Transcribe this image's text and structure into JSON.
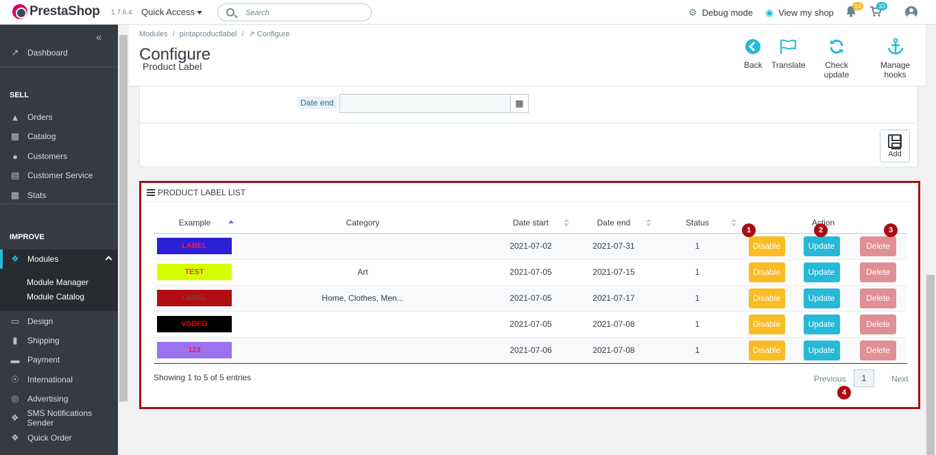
{
  "header": {
    "brand": "PrestaShop",
    "version": "1.7.6.4",
    "quick_access": "Quick Access",
    "search_placeholder": "Search",
    "debug_mode": "Debug mode",
    "view_shop": "View my shop",
    "notifications_count": "14",
    "orders_count": "33"
  },
  "sidebar": {
    "dashboard": "Dashboard",
    "section_sell": "SELL",
    "orders": "Orders",
    "catalog": "Catalog",
    "customers": "Customers",
    "customer_service": "Customer Service",
    "stats": "Stats",
    "section_improve": "IMPROVE",
    "modules": "Modules",
    "module_manager": "Module Manager",
    "module_catalog": "Module Catalog",
    "design": "Design",
    "shipping": "Shipping",
    "payment": "Payment",
    "international": "International",
    "advertising": "Advertising",
    "sms": "SMS Notifications Sender",
    "quick_order": "Quick Order"
  },
  "breadcrumb": {
    "modules": "Modules",
    "module": "pintaproductlabel",
    "current": "Configure"
  },
  "page": {
    "title": "Configure",
    "subtitle": "Product Label"
  },
  "toolbar": {
    "back": "Back",
    "translate": "Translate",
    "check_update": "Check update",
    "manage_hooks": "Manage hooks"
  },
  "form": {
    "date_end_label": "Date end",
    "date_end_value": "",
    "add_label": "Add"
  },
  "list": {
    "title": "PRODUCT LABEL LIST",
    "columns": {
      "example": "Example",
      "category": "Category",
      "date_start": "Date start",
      "date_end": "Date end",
      "status": "Status",
      "action": "Action"
    },
    "rows": [
      {
        "label": "LABEL",
        "bg": "#2a20d6",
        "fg": "#ff1744",
        "category": "",
        "date_start": "2021-07-02",
        "date_end": "2021-07-31",
        "status": "1"
      },
      {
        "label": "TEST",
        "bg": "#d4ff00",
        "fg": "#e53935",
        "category": "Art",
        "date_start": "2021-07-05",
        "date_end": "2021-07-15",
        "status": "1"
      },
      {
        "label": "LABEL",
        "bg": "#b00e12",
        "fg": "#8a3a3a",
        "category": "Home, Clothes, Men...",
        "date_start": "2021-07-05",
        "date_end": "2021-07-17",
        "status": "1"
      },
      {
        "label": "VSDFG",
        "bg": "#000000",
        "fg": "#ff0000",
        "category": "",
        "date_start": "2021-07-05",
        "date_end": "2021-07-08",
        "status": "1"
      },
      {
        "label": "123",
        "bg": "#9b72f0",
        "fg": "#ff1744",
        "category": "",
        "date_start": "2021-07-06",
        "date_end": "2021-07-08",
        "status": "1"
      }
    ],
    "btn_disable": "Disable",
    "btn_update": "Update",
    "btn_delete": "Delete",
    "showing": "Showing 1 to 5 of 5 entries",
    "pager_prev": "Previous",
    "pager_page": "1",
    "pager_next": "Next"
  },
  "markers": {
    "m1": "1",
    "m2": "2",
    "m3": "3",
    "m4": "4"
  },
  "colors": {
    "accent": "#25b9d7",
    "warning": "#fbbb22",
    "danger_light": "#e08f95",
    "highlight_border": "#a90c14",
    "sidebar_bg": "#363a41"
  }
}
